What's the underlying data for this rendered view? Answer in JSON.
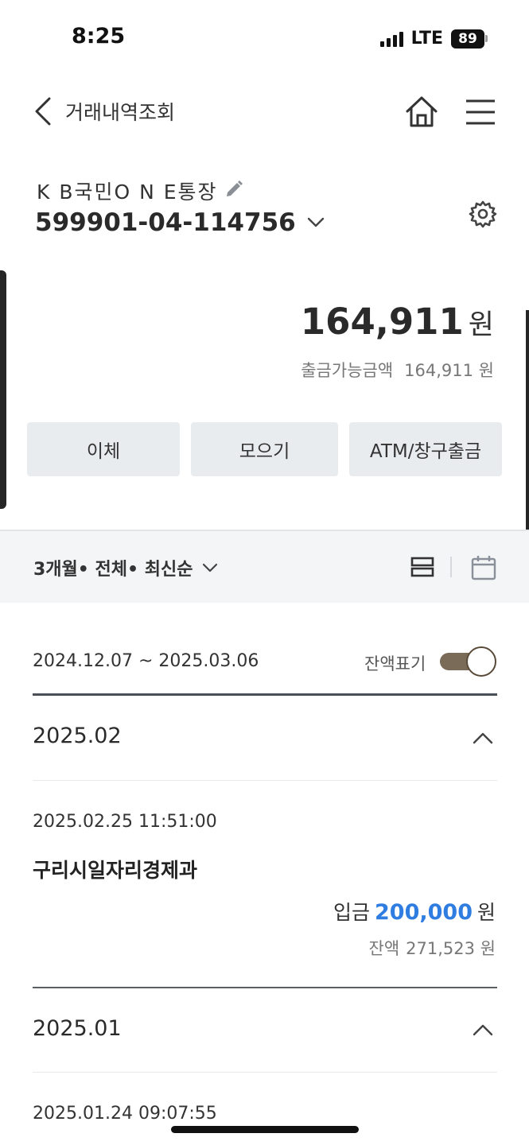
{
  "status_bar": {
    "time": "8:25",
    "network": "LTE",
    "battery": "89"
  },
  "header": {
    "title": "거래내역조회",
    "back_icon": "chevron-left-icon",
    "home_icon": "home-icon",
    "menu_icon": "hamburger-menu-icon"
  },
  "account": {
    "name": "K B국민O N E통장",
    "number": "599901-04-114756",
    "balance": "164,911",
    "balance_unit": "원",
    "available_label": "출금가능금액",
    "available_amount": "164,911 원"
  },
  "actions": [
    {
      "label": "이체"
    },
    {
      "label": "모으기"
    },
    {
      "label": "ATM/창구출금"
    }
  ],
  "filter": {
    "summary": "3개월• 전체• 최신순"
  },
  "range": {
    "dates": "2024.12.07 ~ 2025.03.06",
    "toggle_label": "잔액표기",
    "toggle_on": true
  },
  "months": [
    {
      "label": "2025.02",
      "transactions": [
        {
          "datetime": "2025.02.25 11:51:00",
          "name": "구리시일자리경제과",
          "type": "입금",
          "amount": "200,000",
          "unit": "원",
          "balance_label": "잔액",
          "balance": "271,523 원"
        }
      ]
    },
    {
      "label": "2025.01",
      "transactions": [
        {
          "datetime": "2025.01.24 09:07:55"
        }
      ]
    }
  ],
  "colors": {
    "accent_blue": "#2f7de1",
    "button_bg": "#e9ecef",
    "toggle_track": "#7a6a58"
  }
}
